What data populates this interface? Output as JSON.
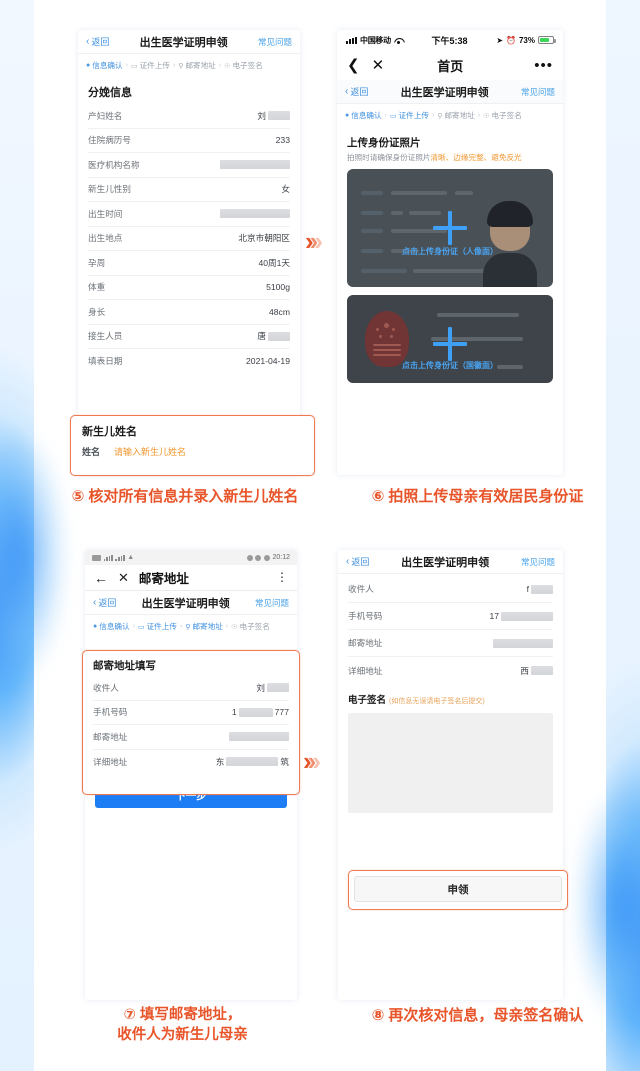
{
  "panels": {
    "step5": {
      "sub_header": {
        "back": "返回",
        "title": "出生医学证明申领",
        "faq": "常见问题"
      },
      "steps": [
        {
          "label": "信息确认",
          "icon": "info-icon",
          "active": true
        },
        {
          "label": "证件上传",
          "icon": "card-icon",
          "active": false
        },
        {
          "label": "邮寄地址",
          "icon": "pin-icon",
          "active": false
        },
        {
          "label": "电子签名",
          "icon": "sign-icon",
          "active": false
        }
      ],
      "section_title": "分娩信息",
      "rows": [
        {
          "label": "产妇姓名",
          "value": "刘",
          "redacted": "w1"
        },
        {
          "label": "住院病历号",
          "value": "233",
          "redacted": ""
        },
        {
          "label": "医疗机构名称",
          "value": "",
          "redacted": "w6"
        },
        {
          "label": "新生儿性别",
          "value": "女",
          "redacted": ""
        },
        {
          "label": "出生时间",
          "value": "",
          "redacted": "w6"
        },
        {
          "label": "出生地点",
          "value": "北京市朝阳区",
          "redacted": ""
        },
        {
          "label": "孕周",
          "value": "40周1天",
          "redacted": ""
        },
        {
          "label": "体重",
          "value": "5100g",
          "redacted": ""
        },
        {
          "label": "身长",
          "value": "48cm",
          "redacted": ""
        },
        {
          "label": "接生人员",
          "value": "唐",
          "redacted": "w1"
        },
        {
          "label": "填表日期",
          "value": "2021-04-19",
          "redacted": ""
        }
      ],
      "highlight": {
        "title": "新生儿姓名",
        "field_label": "姓名",
        "field_placeholder": "请输入新生儿姓名"
      }
    },
    "step6": {
      "status_bar": {
        "carrier": "中国移动",
        "time": "下午5:38",
        "battery": "73%"
      },
      "wx_nav": {
        "title": "首页"
      },
      "sub_header": {
        "back": "返回",
        "title": "出生医学证明申领",
        "faq": "常见问题"
      },
      "steps": [
        {
          "label": "信息确认",
          "icon": "info-icon",
          "active": true
        },
        {
          "label": "证件上传",
          "icon": "card-icon",
          "active": true
        },
        {
          "label": "邮寄地址",
          "icon": "pin-icon",
          "active": false
        },
        {
          "label": "电子签名",
          "icon": "sign-icon",
          "active": false
        }
      ],
      "upload_title": "上传身份证照片",
      "upload_sub_plain": "拍照时请确保身份证照片",
      "upload_sub_accent": "清晰、边缘完整、避免反光",
      "card_front_hint": "点击上传身份证（人像面）",
      "card_back_hint": "点击上传身份证（国徽面）"
    },
    "step7": {
      "status_bar": {
        "time": "20:12"
      },
      "and_nav": {
        "title": "邮寄地址"
      },
      "sub_header": {
        "back": "返回",
        "title": "出生医学证明申领",
        "faq": "常见问题"
      },
      "steps": [
        {
          "label": "信息确认",
          "icon": "info-icon",
          "active": true
        },
        {
          "label": "证件上传",
          "icon": "card-icon",
          "active": true
        },
        {
          "label": "邮寄地址",
          "icon": "pin-icon",
          "active": true
        },
        {
          "label": "电子签名",
          "icon": "sign-icon",
          "active": false
        }
      ],
      "highlight_title": "邮寄地址填写",
      "rows": [
        {
          "label": "收件人",
          "value": "刘",
          "redacted": "w1"
        },
        {
          "label": "手机号码",
          "value": "1",
          "value2": "777",
          "redacted": "w2"
        },
        {
          "label": "邮寄地址",
          "value": "",
          "redacted": "w4"
        },
        {
          "label": "详细地址",
          "value": "东",
          "value2": "筑",
          "redacted": "w3"
        }
      ],
      "next_button": "下一步"
    },
    "step8": {
      "sub_header": {
        "back": "返回",
        "title": "出生医学证明申领",
        "faq": "常见问题"
      },
      "rows": [
        {
          "label": "收件人",
          "value": "f",
          "redacted": "w1"
        },
        {
          "label": "手机号码",
          "value": "17",
          "redacted": "w3"
        },
        {
          "label": "邮寄地址",
          "value": "",
          "redacted": "w4"
        },
        {
          "label": "详细地址",
          "value": "西",
          "redacted": "w1"
        }
      ],
      "sign_title": "电子签名",
      "sign_note": "(如信息无误请电子签名后提交)",
      "claim_button": "申领"
    }
  },
  "captions": {
    "c5": "⑤ 核对所有信息并录入新生儿姓名",
    "c6": "⑥ 拍照上传母亲有效居民身份证",
    "c7_line1": "⑦ 填写邮寄地址，",
    "c7_line2": "收件人为新生儿母亲",
    "c8": "⑧ 再次核对信息，母亲签名确认"
  },
  "colors": {
    "accent_orange": "#e8552a",
    "highlight_border": "#ef7a52",
    "link_blue": "#3d8fe0",
    "primary_blue": "#1d7df5"
  }
}
